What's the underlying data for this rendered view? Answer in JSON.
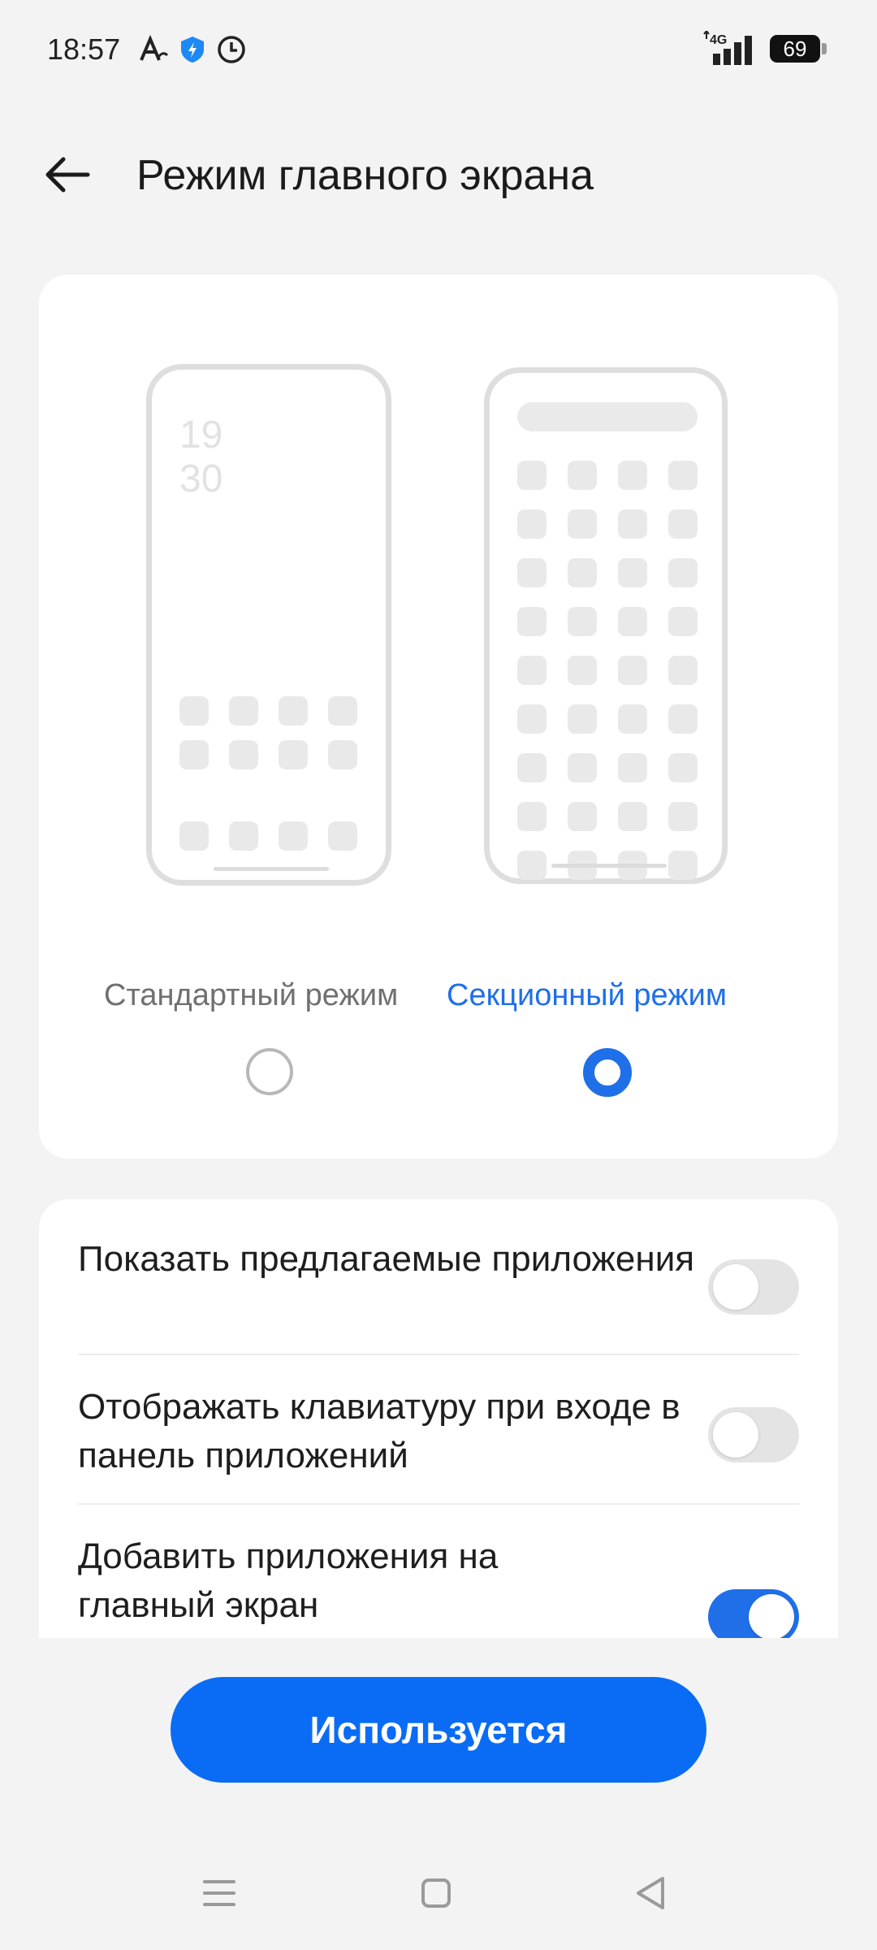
{
  "status_bar": {
    "time": "18:57",
    "network": "4G",
    "battery": "69",
    "icons": [
      "a-accent-icon",
      "shield-icon",
      "clock-icon",
      "signal-icon",
      "battery-icon"
    ]
  },
  "header": {
    "title": "Режим главного экрана",
    "back_icon": "arrow-left-icon"
  },
  "modes": {
    "standard": {
      "label": "Стандартный режим",
      "selected": false,
      "clock": [
        "19",
        "30"
      ]
    },
    "sectioned": {
      "label": "Секционный режим",
      "selected": true
    }
  },
  "settings": [
    {
      "label": "Показать предлагаемые приложения",
      "enabled": false
    },
    {
      "label": "Отображать клавиатуру при входе в панель приложений",
      "enabled": false
    },
    {
      "label": "Добавить приложения на главный экран",
      "enabled": true
    }
  ],
  "action_button": {
    "label": "Используется"
  },
  "colors": {
    "accent": "#1f6fe8",
    "button": "#0a6cf5",
    "background": "#f3f3f3"
  },
  "nav_bar": {
    "icons": [
      "menu-icon",
      "home-square-icon",
      "back-triangle-icon"
    ]
  }
}
